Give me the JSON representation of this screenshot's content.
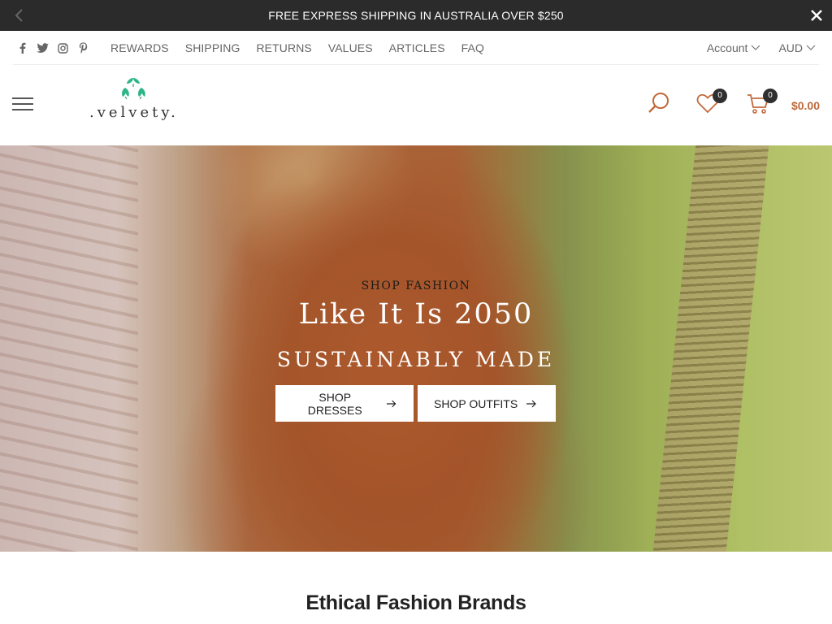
{
  "announcement": {
    "message": "FREE EXPRESS SHIPPING IN AUSTRALIA OVER $250",
    "prev_icon": "chevron-left-icon",
    "close_icon": "close-icon"
  },
  "topbar": {
    "social": [
      "facebook-icon",
      "twitter-icon",
      "instagram-icon",
      "pinterest-icon"
    ],
    "links": [
      "REWARDS",
      "SHIPPING",
      "RETURNS",
      "VALUES",
      "ARTICLES",
      "FAQ"
    ],
    "account_label": "Account",
    "currency_label": "AUD"
  },
  "header": {
    "logo_text": ".velvety.",
    "wishlist_count": "0",
    "cart_count": "0",
    "cart_total": "$0.00"
  },
  "hero": {
    "eyebrow": "SHOP FASHION",
    "headline": "Like It Is 2050",
    "subhead": "SUSTAINABLY MADE",
    "buttons": [
      {
        "label": "SHOP DRESSES"
      },
      {
        "label": "SHOP OUTFITS"
      }
    ]
  },
  "section": {
    "title": "Ethical Fashion Brands"
  },
  "colors": {
    "announcement_bg": "#2b2b2b",
    "accent": "#c0693b",
    "logo_leaf": "#2fb58a"
  }
}
